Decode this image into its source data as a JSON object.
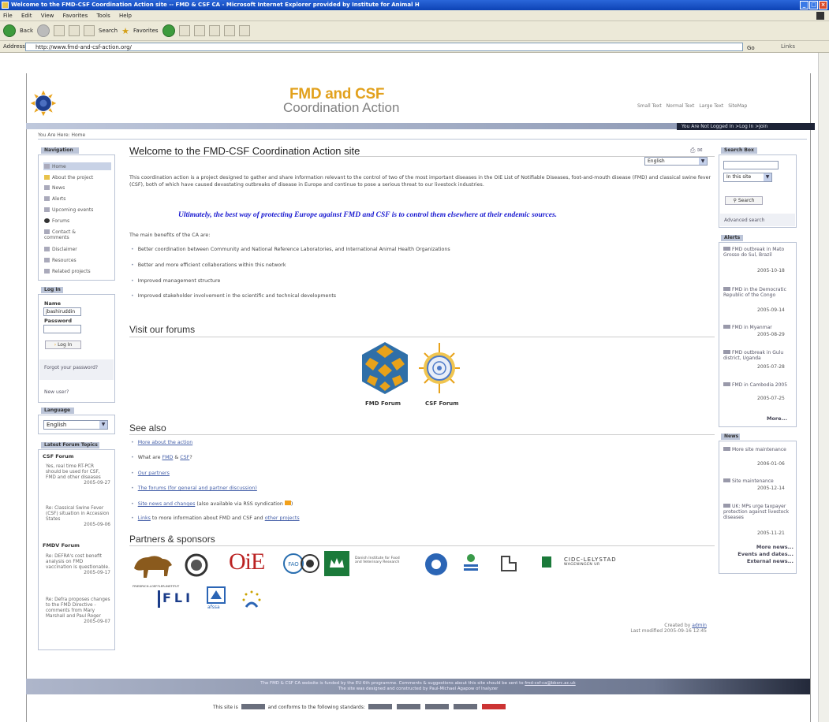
{
  "browser": {
    "title": "Welcome to the FMD-CSF Coordination Action site -- FMD & CSF CA - Microsoft Internet Explorer provided by Institute for Animal H",
    "menu": [
      "File",
      "Edit",
      "View",
      "Favorites",
      "Tools",
      "Help"
    ],
    "toolbar": {
      "back": "Back",
      "search": "Search",
      "favorites": "Favorites"
    },
    "address_label": "Address",
    "address": "http://www.fmd-and-csf-action.org/",
    "go": "Go",
    "links": "Links"
  },
  "header": {
    "top_links": [
      "Small Text",
      "Normal Text",
      "Large Text",
      "SiteMap"
    ],
    "site_name": "FMD and CSF",
    "site_sub": "Coordination Action",
    "user_bar": "You Are Not Logged In   >Log In   >Join",
    "breadcrumb": "You Are Here: Home"
  },
  "navigation": {
    "title": "Navigation",
    "items": [
      "Home",
      "About the project",
      "News",
      "Alerts",
      "Upcoming events",
      "Forums",
      "Contact & comments",
      "Disclaimer",
      "Resources",
      "Related projects"
    ]
  },
  "login": {
    "title": "Log In",
    "name_label": "Name",
    "name_value": "jbashiruddin",
    "password_label": "Password",
    "button": "Log In",
    "forgot": "Forgot your password?",
    "new_user": "New user?"
  },
  "language": {
    "title": "Language",
    "value": "English"
  },
  "latest_forum": {
    "title": "Latest Forum Topics",
    "csf_title": "CSF Forum",
    "csf": [
      {
        "text": "Yes, real time RT-PCR should be used for CSF, FMD and other diseases",
        "date": "2005-09-27"
      },
      {
        "text": "Re: Classical Swine Fever (CSF) situation in Accession States",
        "date": "2005-09-06"
      }
    ],
    "fmd_title": "FMDV Forum",
    "fmd": [
      {
        "text": "Re: DEFRA's cost benefit analysis on FMD vaccination is questionable.",
        "date": "2005-09-17"
      },
      {
        "text": "Re: Defra proposes changes to the FMD Directive - comments from Mary Marshall and Paul Roger",
        "date": "2005-09-07"
      }
    ]
  },
  "main": {
    "title": "Welcome to the FMD-CSF Coordination Action site",
    "lang": "English",
    "intro": "This coordination action is a project designed to gather and share information relevant to the control of two of the most important diseases in the OIE List of Notifiable Diseases, foot-and-mouth disease (FMD) and classical swine fever (CSF), both of which have caused devastating outbreaks of disease in Europe and continue to pose a serious threat to our livestock industries.",
    "quote": "Ultimately, the best way of protecting Europe against FMD and CSF is to control them elsewhere at their endemic sources.",
    "benefits_intro": "The main benefits of the CA are:",
    "benefits": [
      "Better coordination between Community and National Reference Laboratories, and International Animal Health Organizations",
      "Better and more efficient collaborations within this network",
      "Improved management structure",
      "Improved stakeholder involvement in the scientific and technical developments"
    ],
    "forums_heading": "Visit our forums",
    "fmd_forum": "FMD Forum",
    "csf_forum": "CSF Forum",
    "see_also_heading": "See also",
    "see_also": {
      "s1": "More about the action",
      "s2_pre": "What are ",
      "s2_fmd": "FMD",
      "s2_mid": " & ",
      "s2_csf": "CSF",
      "s2_post": "?",
      "s3": "Our partners",
      "s4": "The forums (for general and partner discussion)",
      "s5": "Site news and changes",
      "s5_post": " (also available via RSS syndication",
      "s5_end": ")",
      "s6_link": "Links",
      "s6_mid": " to more information about FMD and CSF and ",
      "s6_link2": "other projects"
    },
    "partners_heading": "Partners & sponsors",
    "sponsor_text_1": "Danish Institute for Food and Veterinary Research",
    "sponsor_text_2": "CIDC-LELYSTAD",
    "sponsor_text_3": "WAGENINGEN UR",
    "sponsor_fli_top": "FRIEDRICH-LOEFFLER-INSTITUT",
    "sponsor_fli": "FLI",
    "sponsor_afssa": "afssa",
    "sponsor_oie": "OiE",
    "sponsor_iah": "IAH",
    "created_by": "Created by",
    "admin": "admin",
    "last_modified": "Last modified 2005-09-16 12:45"
  },
  "right": {
    "search_title": "Search Box",
    "scope": "In this site",
    "search_button": "Search",
    "advanced": "Advanced search",
    "alerts_title": "Alerts",
    "alerts": [
      {
        "text": "FMD outbreak in Mato Grosso do Sul, Brazil",
        "date": "2005-10-18"
      },
      {
        "text": "FMD in the Democratic Republic of the Congo",
        "date": "2005-09-14"
      },
      {
        "text": "FMD in Myanmar",
        "date": "2005-08-29"
      },
      {
        "text": "FMD outbreak in Gulu district, Uganda",
        "date": "2005-07-28"
      },
      {
        "text": "FMD in Cambodia 2005",
        "date": "2005-07-25"
      }
    ],
    "alerts_more": "More...",
    "news_title": "News",
    "news": [
      {
        "text": "More site maintenance",
        "date": "2006-01-06"
      },
      {
        "text": "Site maintenance",
        "date": "2005-12-14"
      },
      {
        "text": "UK: MPs urge taxpayer protection against livestock diseases",
        "date": "2005-11-21"
      }
    ],
    "more_news": "More news...",
    "events": "Events and dates...",
    "external_news": "External news..."
  },
  "footer": {
    "line1": "The FMD & CSF CA website is funded by the EU 6th programme. Comments & suggestions about this site should be sent to",
    "email": "fmd-csf-ca@bbsrc.ac.uk",
    "line2": "The site was designed and constructed by Paul-Michael Agapow of Inalyzer",
    "standards_pre": "This site is",
    "standards_mid": "and conforms to the following standards:"
  }
}
